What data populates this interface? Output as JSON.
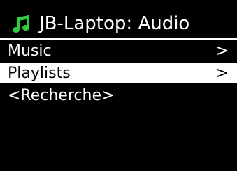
{
  "header": {
    "title": "JB-Laptop: Audio",
    "icon": "music-note-icon",
    "icon_color": "#2ecc40"
  },
  "menu": {
    "items": [
      {
        "label": "Music",
        "arrow": ">",
        "selected": false
      },
      {
        "label": "Playlists",
        "arrow": ">",
        "selected": true
      },
      {
        "label": "<Recherche>",
        "arrow": "",
        "selected": false
      }
    ]
  },
  "colors": {
    "background": "#000000",
    "text": "#ffffff",
    "highlight": "#ffffff",
    "highlight_text": "#000000"
  }
}
